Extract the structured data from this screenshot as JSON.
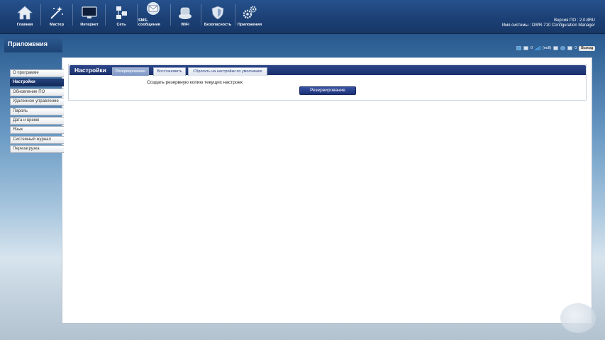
{
  "nav": {
    "items": [
      {
        "label": "Главная",
        "icon": "home-icon"
      },
      {
        "label": "Мастер",
        "icon": "wizard-icon"
      },
      {
        "label": "Интернет",
        "icon": "monitor-icon"
      },
      {
        "label": "Сеть",
        "icon": "network-icon"
      },
      {
        "label": "SMS-сообщения",
        "icon": "envelope-icon"
      },
      {
        "label": "WiFi",
        "icon": "router-icon"
      },
      {
        "label": "Безопасность",
        "icon": "shield-icon"
      },
      {
        "label": "Приложения",
        "icon": "gears-icon"
      }
    ]
  },
  "system": {
    "version_text": "Версия ПО : 2.0.8RU",
    "name_text": "Имя системы : DWR-710 Configuration Manager"
  },
  "section": {
    "title": "Приложения"
  },
  "status": {
    "count1": "0",
    "signal": "(null)",
    "count2": "0",
    "logout": "Выход"
  },
  "sidebar": {
    "items": [
      {
        "label": "О программе"
      },
      {
        "label": "Настройки",
        "active": true
      },
      {
        "label": "Обновление ПО"
      },
      {
        "label": "Удаленное управление"
      },
      {
        "label": "Пароль"
      },
      {
        "label": "Дата и время"
      },
      {
        "label": "Язык"
      },
      {
        "label": "Системный журнал"
      },
      {
        "label": "Перезагрузка"
      }
    ]
  },
  "panel": {
    "title": "Настройки",
    "tabs": [
      {
        "label": "Резервирование",
        "active": true
      },
      {
        "label": "Восстановить"
      },
      {
        "label": "Сбросить на настройки по умолчанию"
      }
    ],
    "description": "Создать резервную копию текущих настроек",
    "button": "Резервирование"
  },
  "colors": {
    "header": "#1b3f74",
    "active": "#142c5c",
    "panel_header": "#1a2f6b"
  }
}
